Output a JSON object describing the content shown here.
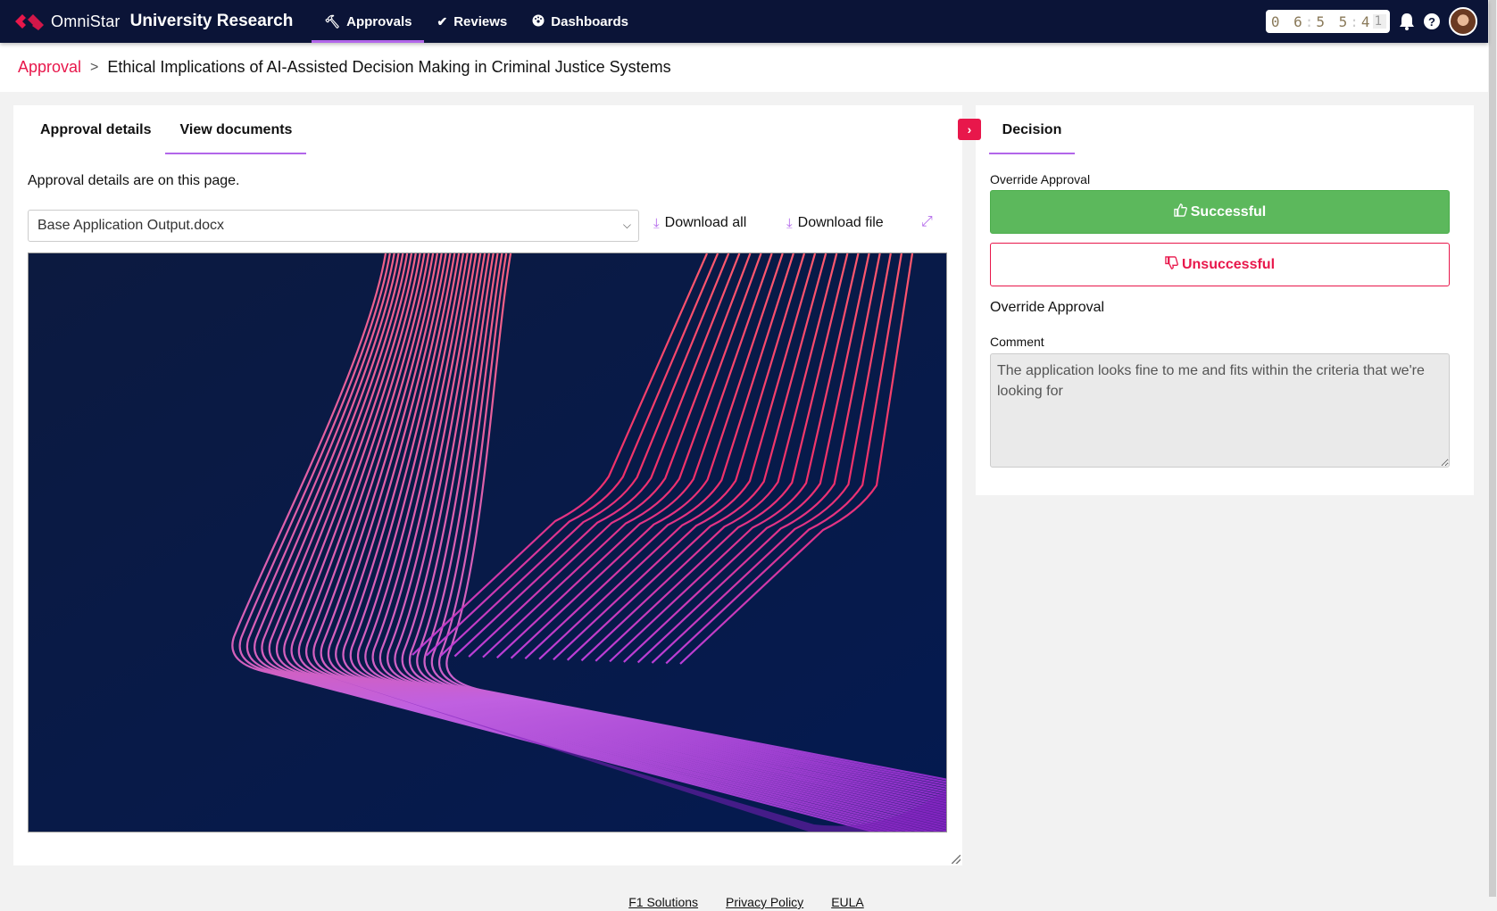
{
  "header": {
    "brand_name": "OmniStar",
    "app_name": "University Research",
    "nav": [
      {
        "label": "Approvals",
        "icon": "gavel-icon",
        "active": true
      },
      {
        "label": "Reviews",
        "icon": "check-icon",
        "active": false
      },
      {
        "label": "Dashboards",
        "icon": "dashboard-icon",
        "active": false
      }
    ],
    "clock": {
      "h": "0 6",
      "m": "5 5",
      "s1": "4",
      "s2": "1"
    },
    "colors": {
      "topbar": "#0b1437",
      "accent": "#e8174b",
      "tab_underline": "#b266ea"
    }
  },
  "breadcrumb": {
    "root": "Approval",
    "separator": ">",
    "current": "Ethical Implications of AI-Assisted Decision Making in Criminal Justice Systems"
  },
  "left_panel": {
    "tabs": [
      {
        "label": "Approval details",
        "active": false
      },
      {
        "label": "View documents",
        "active": true
      }
    ],
    "intro_text": "Approval details are on this page.",
    "document_select": {
      "selected": "Base Application Output.docx"
    },
    "download_all_label": "Download all",
    "download_file_label": "Download file"
  },
  "right_panel": {
    "tab_label": "Decision",
    "override_label": "Override Approval",
    "successful_label": "Successful",
    "unsuccessful_label": "Unsuccessful",
    "section_title": "Override Approval",
    "comment_label": "Comment",
    "comment_value": "The application looks fine to me and fits within the criteria that we're looking for",
    "colors": {
      "success": "#5cb85c",
      "danger": "#e8174b"
    }
  },
  "footer": {
    "links": [
      "F1 Solutions",
      "Privacy Policy",
      "EULA"
    ]
  }
}
